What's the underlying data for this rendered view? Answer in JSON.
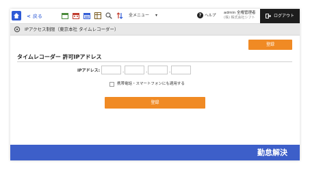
{
  "topbar": {
    "back_label": "戻る",
    "menu_label": "全メニュー",
    "menu_caret": "▾",
    "help_label": "ヘルプ",
    "help_glyph": "?",
    "user_name": "admin 全権管理者",
    "user_company": "(株) 株式会社シフト",
    "logout_label": "ログアウト",
    "tools": [
      "calendar-icon",
      "calendar-grid-icon",
      "calendar-list-icon",
      "table-icon",
      "search-icon",
      "sort-icon"
    ]
  },
  "breadcrumb": {
    "text": "IPアクセス制限（東京本社 タイムレコーダー）"
  },
  "form": {
    "register_top_label": "登録",
    "title": "タイムレコーダー 許可IPアドレス",
    "ip_label": "IPアドレス:",
    "ip_values": [
      "",
      "",
      "",
      ""
    ],
    "ip_separator": ".",
    "mobile_checkbox_label": "携帯電話・スマートフォンにも適用する",
    "mobile_checkbox_checked": false,
    "register_main_label": "登録"
  },
  "footer": {
    "text": "勤怠解決"
  },
  "colors": {
    "accent_blue": "#2f5bd6",
    "footer_blue": "#3d5fc9",
    "button_orange": "#f08a24",
    "logout_bg": "#1d1d1d"
  }
}
